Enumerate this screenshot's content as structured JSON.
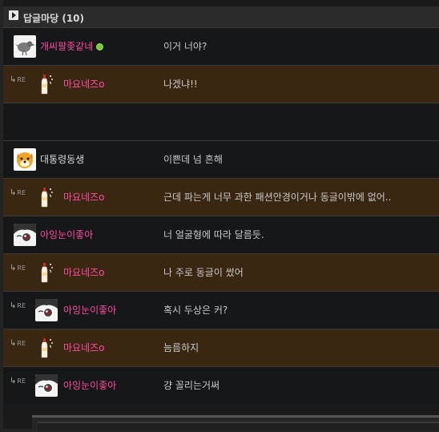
{
  "header": {
    "title": "답글마당 (10)"
  },
  "rows": [
    {
      "type": "comment",
      "nick": "개씨팔좆같네",
      "nick_color": "#ff4aa2",
      "online": true,
      "avatar": "bird-avatar-icon",
      "text": "이거 너야?"
    },
    {
      "type": "reply",
      "nick": "마요네즈o",
      "nick_color": "#ff4aa2",
      "avatar": "mayo-bottle-avatar-icon",
      "re": "RE",
      "text": "나겠냐!!"
    },
    {
      "type": "spacer"
    },
    {
      "type": "comment",
      "nick": "대통령동생",
      "nick_color": "#d7d7d7",
      "avatar": "dog-face-avatar-icon",
      "text": "이쁜데 넘 흔해"
    },
    {
      "type": "reply",
      "nick": "마요네즈o",
      "nick_color": "#ff4aa2",
      "avatar": "mayo-bottle-avatar-icon",
      "re": "RE",
      "text": "근데 파는게 너무 과한 패션안경이거나 동글이밖에 없어.."
    },
    {
      "type": "comment",
      "nick": "아잉눈이좋아",
      "nick_color": "#ff4aa2",
      "avatar": "anime-face-avatar-icon",
      "text": "너 얼굴형에 따라 달름듯."
    },
    {
      "type": "reply",
      "nick": "마요네즈o",
      "nick_color": "#ff4aa2",
      "avatar": "mayo-bottle-avatar-icon",
      "re": "RE",
      "text": "나 주로 동글이 썼어"
    },
    {
      "type": "sub",
      "nick": "아잉눈이좋아",
      "nick_color": "#ff4aa2",
      "avatar": "anime-face-avatar-icon",
      "re": "RE",
      "text": "혹시 두상은 커?"
    },
    {
      "type": "reply",
      "nick": "마요네즈o",
      "nick_color": "#ff4aa2",
      "avatar": "mayo-bottle-avatar-icon",
      "re": "RE",
      "text": "늠름하지"
    },
    {
      "type": "sub",
      "nick": "아잉눈이좋아",
      "nick_color": "#ff4aa2",
      "avatar": "anime-face-avatar-icon",
      "re": "RE",
      "text": "걍 꼴리는거써"
    }
  ]
}
